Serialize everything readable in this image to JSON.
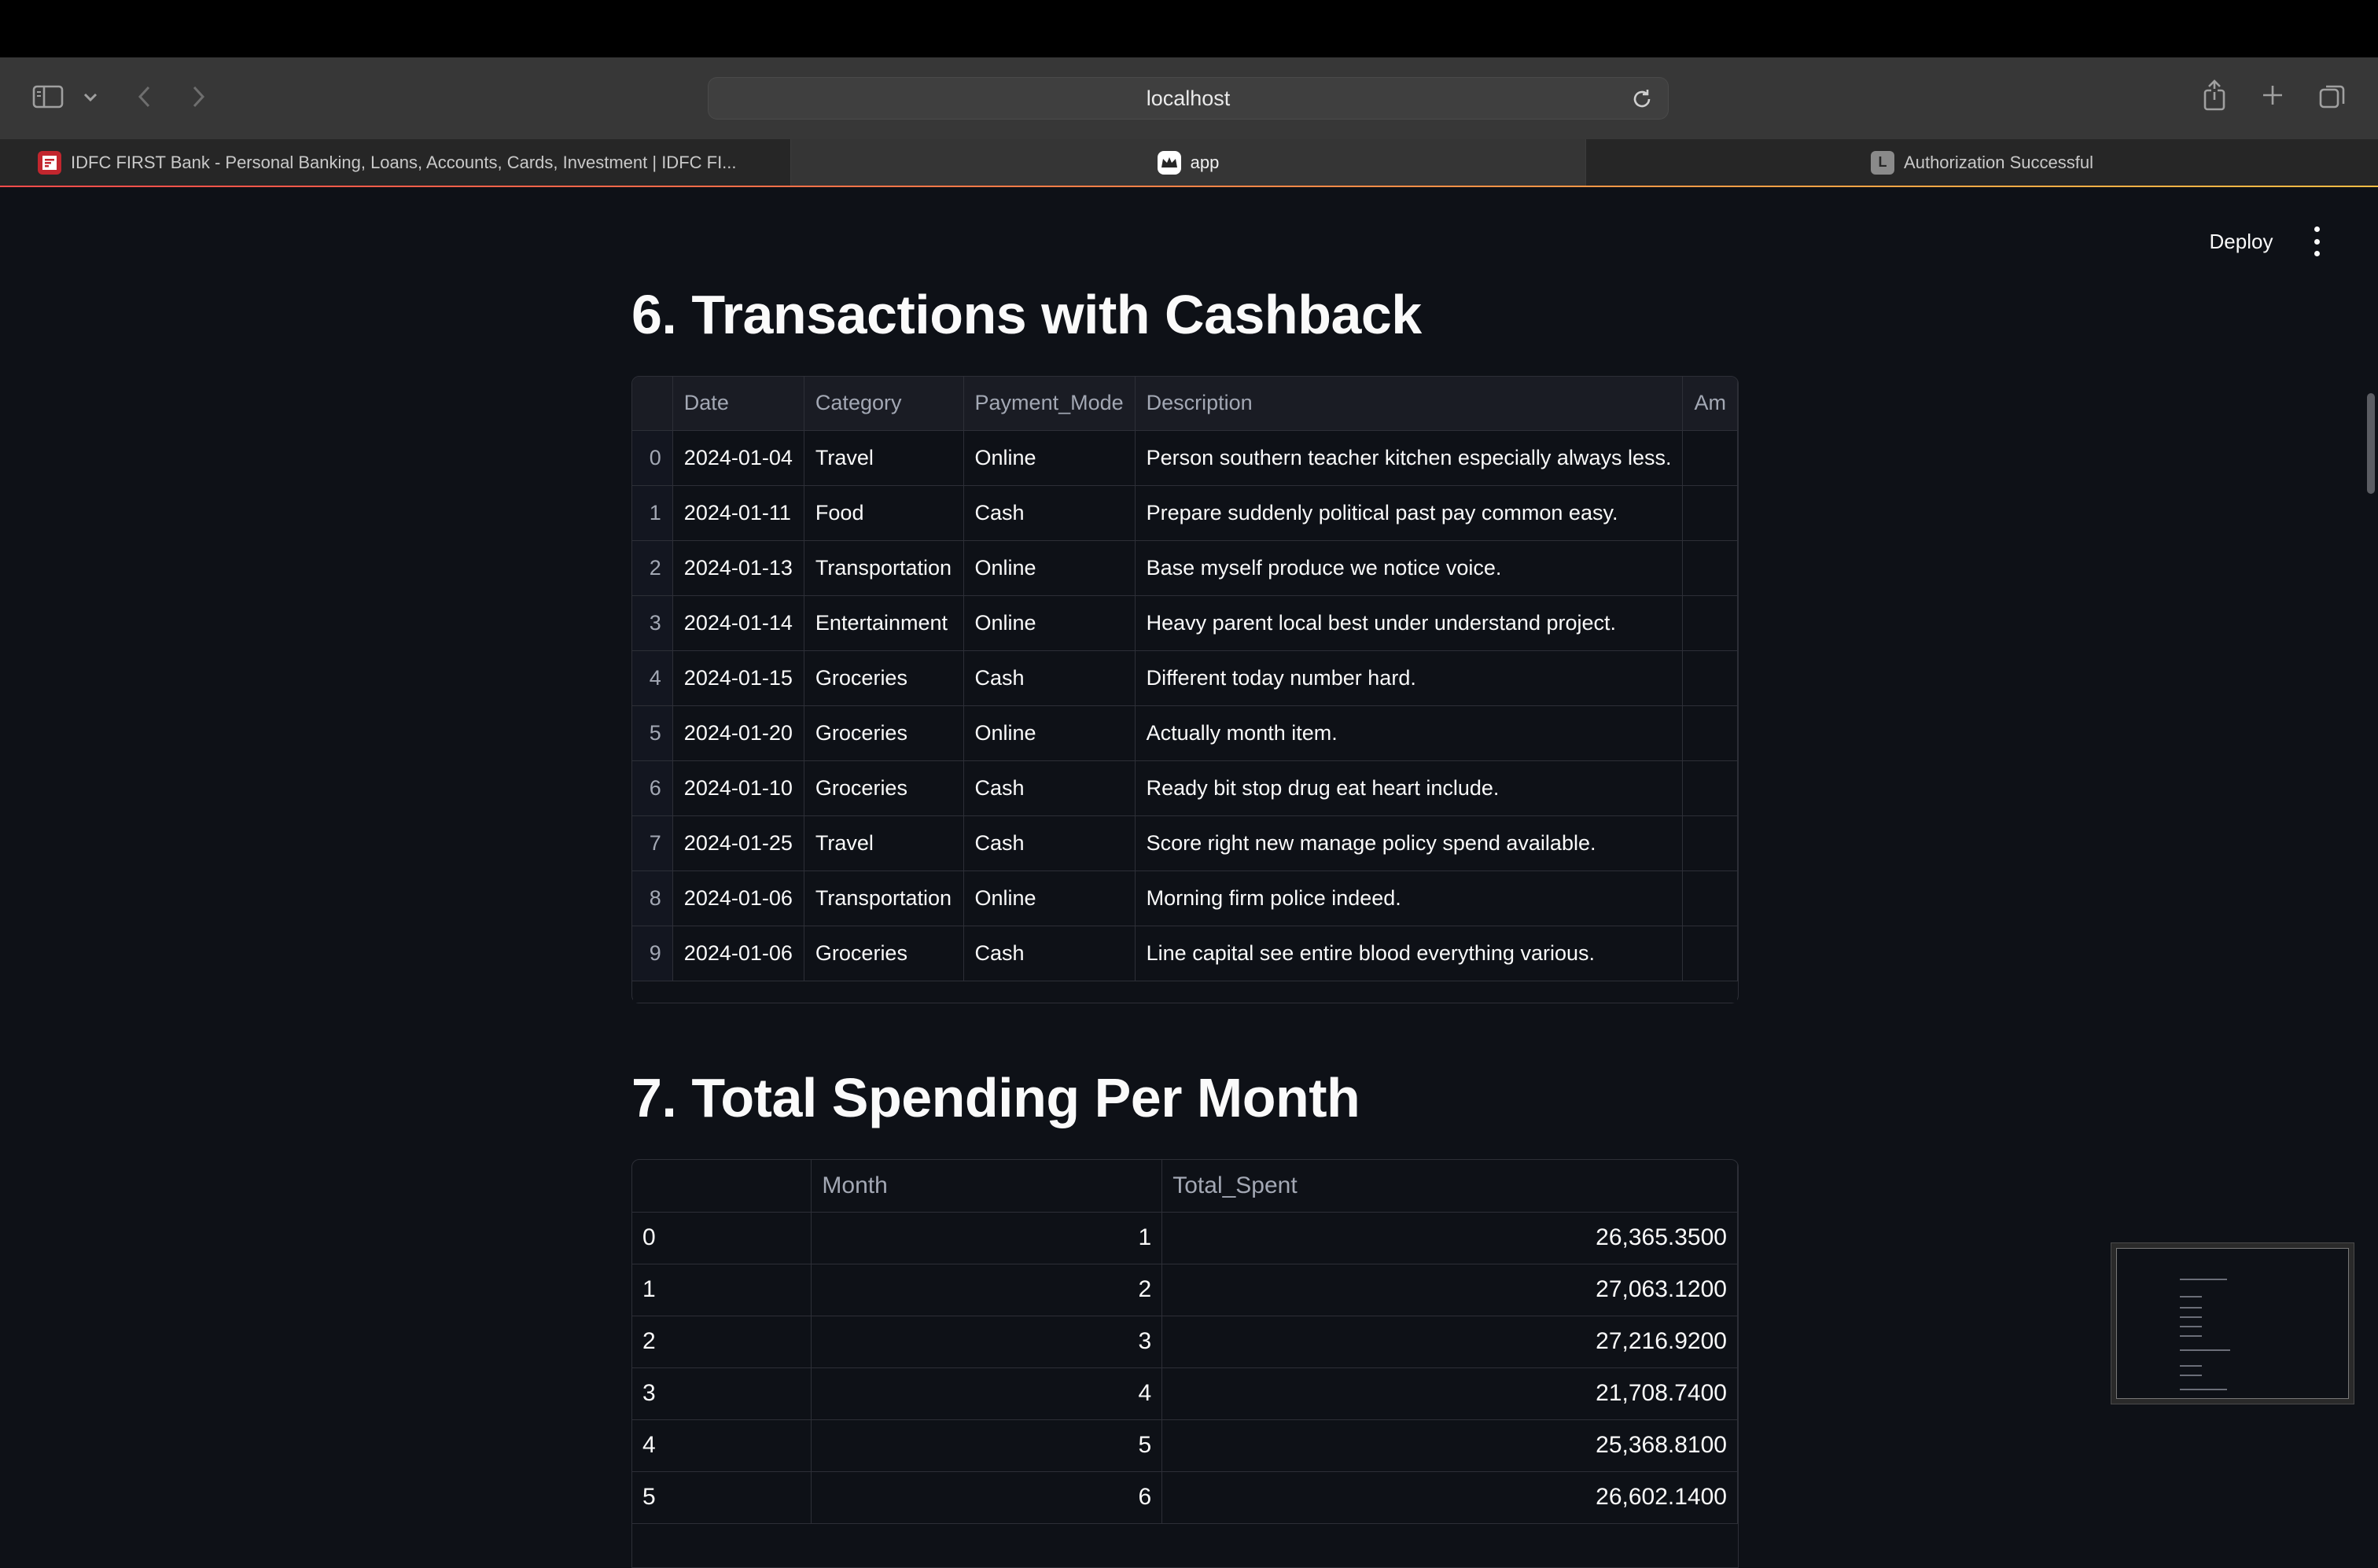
{
  "browser": {
    "address": "localhost",
    "tabs": [
      {
        "title": "IDFC FIRST Bank - Personal Banking, Loans, Accounts, Cards, Investment | IDFC FI...",
        "active": false
      },
      {
        "title": "app",
        "active": true
      },
      {
        "title": "Authorization Successful",
        "active": false,
        "favicon_letter": "L"
      }
    ]
  },
  "header": {
    "deploy_label": "Deploy"
  },
  "section6": {
    "title": "6. Transactions with Cashback",
    "columns": [
      "",
      "Date",
      "Category",
      "Payment_Mode",
      "Description",
      "Am"
    ],
    "rows": [
      {
        "idx": "0",
        "date": "2024-01-04",
        "category": "Travel",
        "mode": "Online",
        "desc": "Person southern teacher kitchen especially always less."
      },
      {
        "idx": "1",
        "date": "2024-01-11",
        "category": "Food",
        "mode": "Cash",
        "desc": "Prepare suddenly political past pay common easy."
      },
      {
        "idx": "2",
        "date": "2024-01-13",
        "category": "Transportation",
        "mode": "Online",
        "desc": "Base myself produce we notice voice."
      },
      {
        "idx": "3",
        "date": "2024-01-14",
        "category": "Entertainment",
        "mode": "Online",
        "desc": "Heavy parent local best under understand project."
      },
      {
        "idx": "4",
        "date": "2024-01-15",
        "category": "Groceries",
        "mode": "Cash",
        "desc": "Different today number hard."
      },
      {
        "idx": "5",
        "date": "2024-01-20",
        "category": "Groceries",
        "mode": "Online",
        "desc": "Actually month item."
      },
      {
        "idx": "6",
        "date": "2024-01-10",
        "category": "Groceries",
        "mode": "Cash",
        "desc": "Ready bit stop drug eat heart include."
      },
      {
        "idx": "7",
        "date": "2024-01-25",
        "category": "Travel",
        "mode": "Cash",
        "desc": "Score right new manage policy spend available."
      },
      {
        "idx": "8",
        "date": "2024-01-06",
        "category": "Transportation",
        "mode": "Online",
        "desc": "Morning firm police indeed."
      },
      {
        "idx": "9",
        "date": "2024-01-06",
        "category": "Groceries",
        "mode": "Cash",
        "desc": "Line capital see entire blood everything various."
      }
    ]
  },
  "section7": {
    "title": "7. Total Spending Per Month",
    "columns": [
      "",
      "Month",
      "Total_Spent"
    ],
    "rows": [
      {
        "idx": "0",
        "month": "1",
        "total": "26,365.3500"
      },
      {
        "idx": "1",
        "month": "2",
        "total": "27,063.1200"
      },
      {
        "idx": "2",
        "month": "3",
        "total": "27,216.9200"
      },
      {
        "idx": "3",
        "month": "4",
        "total": "21,708.7400"
      },
      {
        "idx": "4",
        "month": "5",
        "total": "25,368.8100"
      },
      {
        "idx": "5",
        "month": "6",
        "total": "26,602.1400"
      }
    ]
  }
}
